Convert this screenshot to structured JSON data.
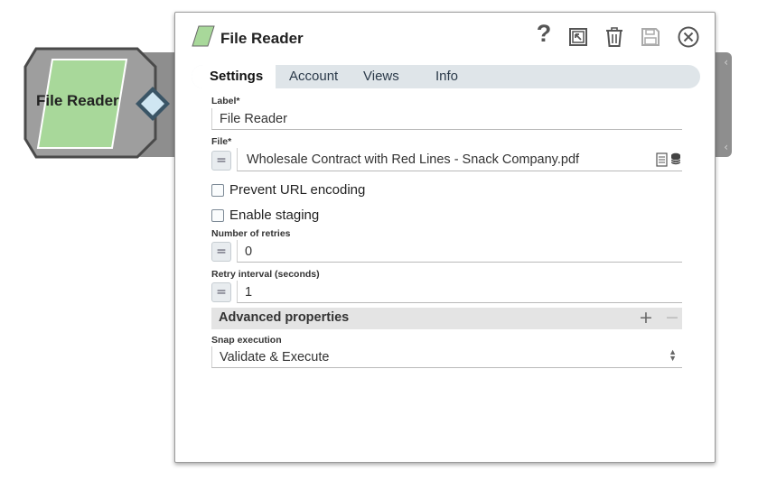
{
  "node": {
    "label": "File Reader",
    "color": "#a8d89a"
  },
  "dialog": {
    "title": "File Reader",
    "help_label": "?",
    "tabs": [
      {
        "label": "Settings",
        "active": true
      },
      {
        "label": "Account"
      },
      {
        "label": "Views"
      },
      {
        "label": "Info"
      }
    ],
    "fields": {
      "label": {
        "caption": "Label*",
        "value": "File Reader"
      },
      "file": {
        "caption": "File*",
        "value": "Wholesale Contract with Red Lines - Snack Company.pdf",
        "eq": "="
      },
      "prevent_url_encoding": {
        "label": "Prevent URL encoding",
        "checked": false
      },
      "enable_staging": {
        "label": "Enable staging",
        "checked": false
      },
      "retries": {
        "caption": "Number of retries",
        "value": "0",
        "eq": "="
      },
      "retry_interval": {
        "caption": "Retry interval (seconds)",
        "value": "1",
        "eq": "="
      },
      "advanced": {
        "title": "Advanced properties",
        "plus": "+",
        "minus": "−"
      },
      "snap_execution": {
        "caption": "Snap execution",
        "value": "Validate & Execute"
      }
    }
  },
  "icons": [
    "question-icon",
    "expand-icon",
    "trash-icon",
    "save-icon",
    "close-icon",
    "file-browse-icon",
    "database-icon"
  ]
}
